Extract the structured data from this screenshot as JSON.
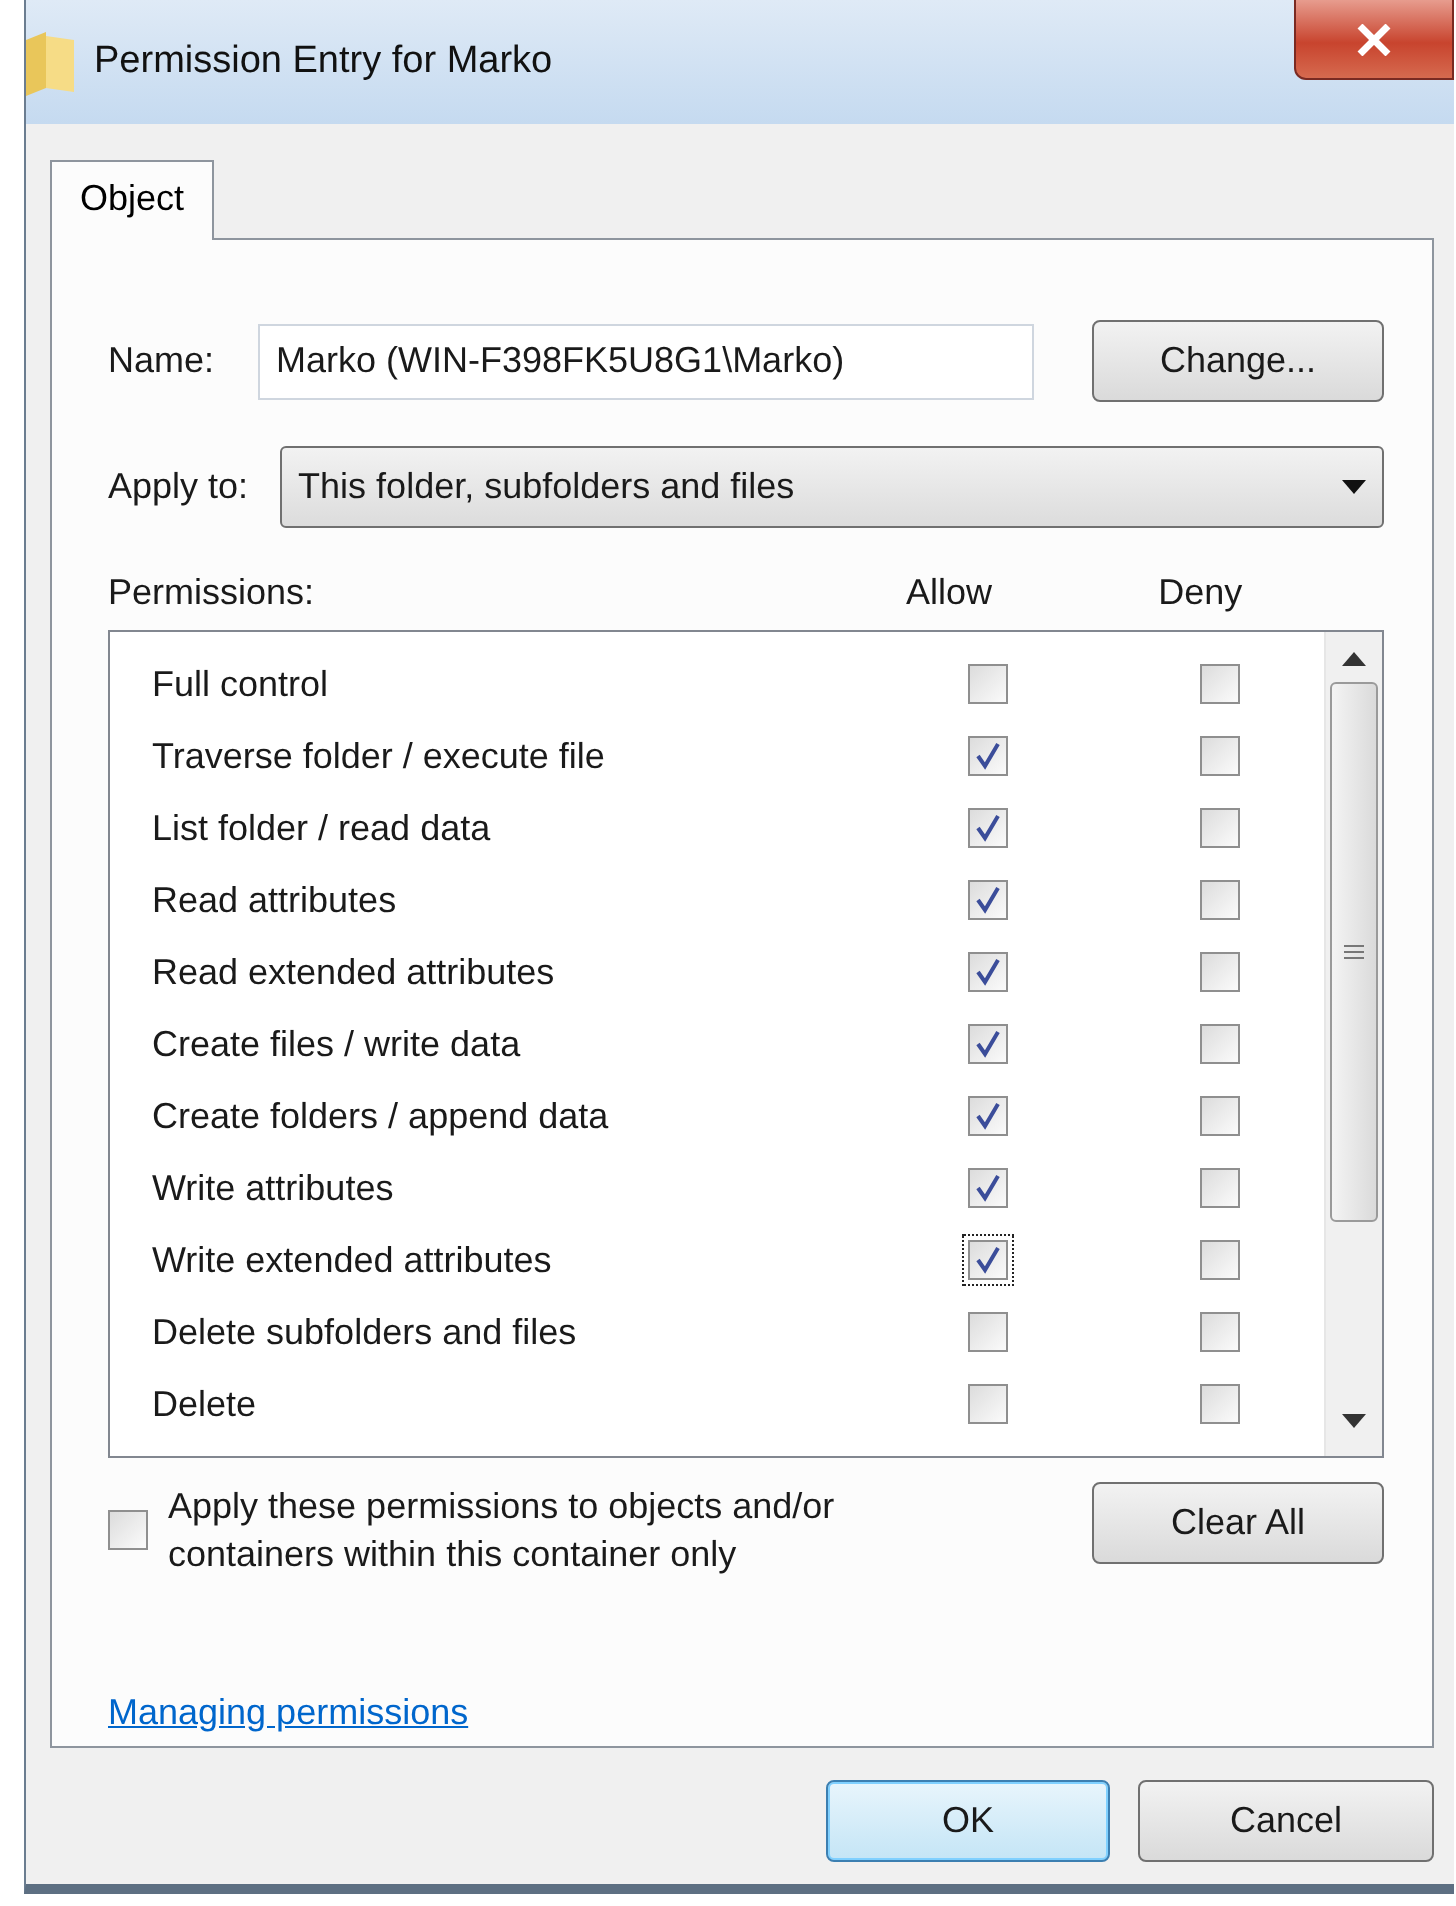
{
  "window": {
    "title": "Permission Entry for Marko"
  },
  "tabs": [
    {
      "label": "Object",
      "selected": true
    }
  ],
  "name": {
    "label": "Name:",
    "value": "Marko (WIN-F398FK5U8G1\\Marko)",
    "button": "Change..."
  },
  "apply_to": {
    "label": "Apply to:",
    "value": "This folder, subfolders and files"
  },
  "permissions": {
    "label": "Permissions:",
    "allow_header": "Allow",
    "deny_header": "Deny",
    "rows": [
      {
        "label": "Full control",
        "allow": false,
        "deny": false,
        "focused": false
      },
      {
        "label": "Traverse folder / execute file",
        "allow": true,
        "deny": false,
        "focused": false
      },
      {
        "label": "List folder / read data",
        "allow": true,
        "deny": false,
        "focused": false
      },
      {
        "label": "Read attributes",
        "allow": true,
        "deny": false,
        "focused": false
      },
      {
        "label": "Read extended attributes",
        "allow": true,
        "deny": false,
        "focused": false
      },
      {
        "label": "Create files / write data",
        "allow": true,
        "deny": false,
        "focused": false
      },
      {
        "label": "Create folders / append data",
        "allow": true,
        "deny": false,
        "focused": false
      },
      {
        "label": "Write attributes",
        "allow": true,
        "deny": false,
        "focused": false
      },
      {
        "label": "Write extended attributes",
        "allow": true,
        "deny": false,
        "focused": true
      },
      {
        "label": "Delete subfolders and files",
        "allow": false,
        "deny": false,
        "focused": false
      },
      {
        "label": "Delete",
        "allow": false,
        "deny": false,
        "focused": false
      }
    ]
  },
  "apply_only": {
    "label": "Apply these permissions to objects and/or containers within this container only",
    "checked": false
  },
  "clear_all": "Clear All",
  "link": "Managing permissions",
  "buttons": [
    {
      "label": "OK",
      "default": true
    },
    {
      "label": "Cancel",
      "default": false
    }
  ]
}
